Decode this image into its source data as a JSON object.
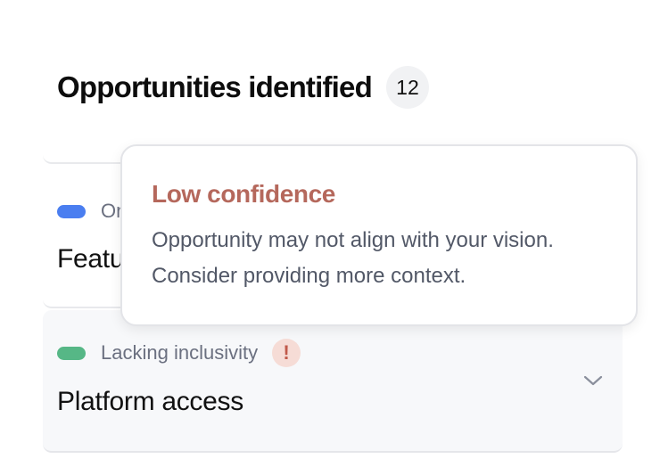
{
  "header": {
    "title": "Opportunities identified",
    "count": "12"
  },
  "items": [
    {
      "tag": "On",
      "title": "Featu",
      "tag_color": "#4a7ef0"
    },
    {
      "tag": "Lacking inclusivity",
      "title": "Platform access",
      "tag_color": "#56b786",
      "alert": "!",
      "chevron_icon": "chevron-down-icon"
    }
  ],
  "tooltip": {
    "title": "Low confidence",
    "line1": "Opportunity may not align with your vision.",
    "line2": "Consider providing more context.",
    "title_color": "#b5685c"
  }
}
